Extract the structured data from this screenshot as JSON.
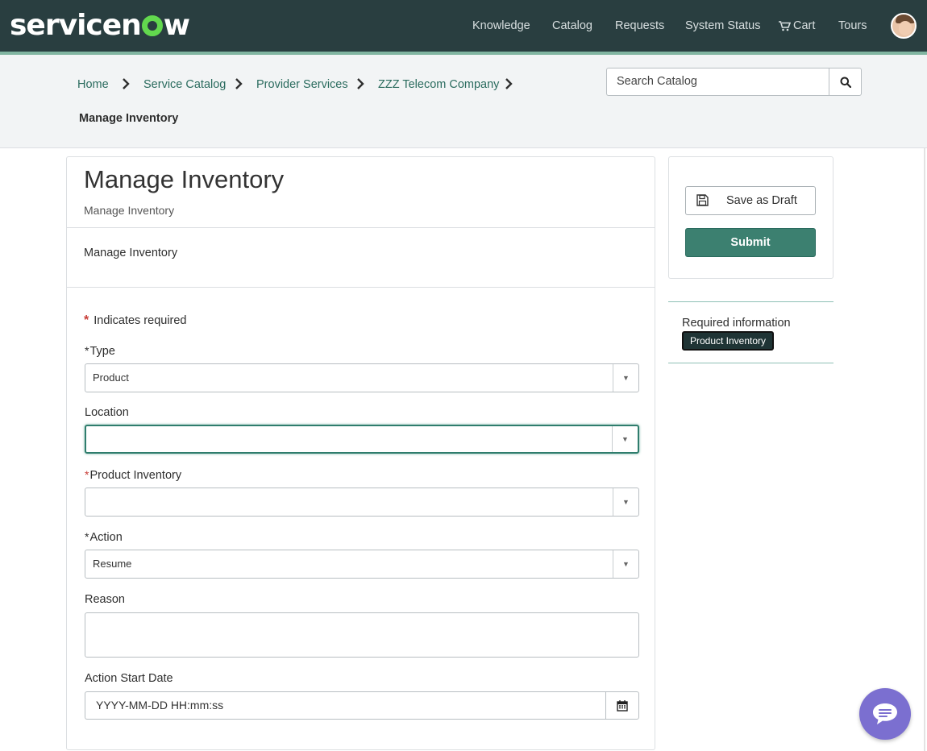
{
  "brand": {
    "logo_pre": "servicen",
    "logo_post": "w"
  },
  "nav": {
    "items": [
      "Knowledge",
      "Catalog",
      "Requests",
      "System Status",
      "Cart",
      "Tours"
    ],
    "cart_icon": "shopping-cart-icon"
  },
  "breadcrumb": {
    "items": [
      "Home",
      "Service Catalog",
      "Provider Services",
      "ZZZ Telecom Company"
    ],
    "current": "Manage Inventory"
  },
  "search": {
    "placeholder": "Search Catalog",
    "icon": "magnifier-icon"
  },
  "form": {
    "title": "Manage Inventory",
    "subtitle": "Manage Inventory",
    "description": "Manage Inventory",
    "required_note": "Indicates required",
    "fields": {
      "type": {
        "label": "Type",
        "value": "Product",
        "mandatory": true
      },
      "location": {
        "label": "Location",
        "value": "",
        "mandatory": false
      },
      "product_inventory": {
        "label": "Product Inventory",
        "value": "",
        "mandatory": true
      },
      "action": {
        "label": "Action",
        "value": "Resume",
        "mandatory": true
      },
      "reason": {
        "label": "Reason",
        "value": ""
      },
      "action_start_date": {
        "label": "Action Start Date",
        "placeholder": "YYYY-MM-DD HH:mm:ss"
      }
    }
  },
  "sidebar": {
    "save_draft": "Save as Draft",
    "submit": "Submit",
    "required_info_label": "Required information",
    "required_badge": "Product Inventory"
  },
  "colors": {
    "header_bg": "#293e40",
    "accent": "#81b5a1",
    "link": "#2a6b5e",
    "submit_bg": "#3c8070",
    "required": "#c83c36",
    "chat_bg": "#7b6fd0"
  }
}
